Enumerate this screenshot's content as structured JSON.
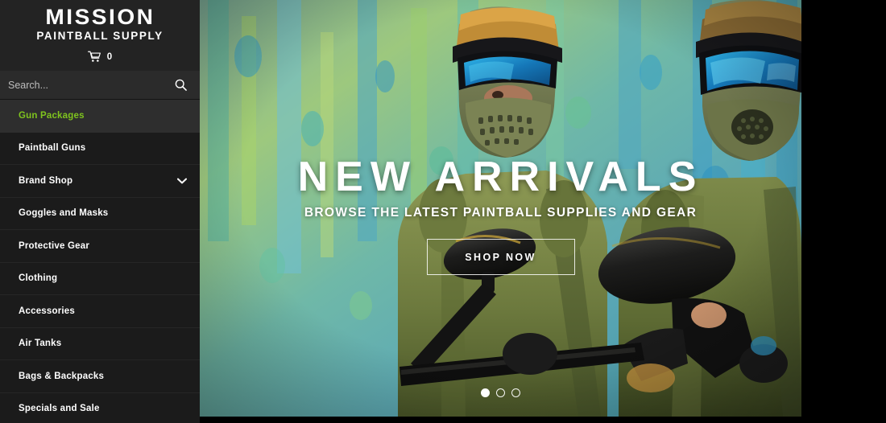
{
  "brand": {
    "name_line1": "MISSION",
    "name_line2": "PAINTBALL SUPPLY",
    "cart_icon": "shopping-cart-icon",
    "cart_count": "0"
  },
  "search": {
    "placeholder": "Search...",
    "value": "",
    "icon": "magnifier-icon"
  },
  "colors": {
    "accent_green": "#7fc41e",
    "sidebar_bg": "#1b1b1b",
    "sidebar_active_bg": "#2e2e2e",
    "header_bg": "#232323",
    "search_bg": "#2b2b2b",
    "page_bg": "#000000"
  },
  "sidebar": {
    "items": [
      {
        "label": "Gun Packages",
        "active": true,
        "expandable": false
      },
      {
        "label": "Paintball Guns",
        "active": false,
        "expandable": false
      },
      {
        "label": "Brand Shop",
        "active": false,
        "expandable": true
      },
      {
        "label": "Goggles and Masks",
        "active": false,
        "expandable": false
      },
      {
        "label": "Protective Gear",
        "active": false,
        "expandable": false
      },
      {
        "label": "Clothing",
        "active": false,
        "expandable": false
      },
      {
        "label": "Accessories",
        "active": false,
        "expandable": false
      },
      {
        "label": "Air Tanks",
        "active": false,
        "expandable": false
      },
      {
        "label": "Bags & Backpacks",
        "active": false,
        "expandable": false
      },
      {
        "label": "Specials and Sale",
        "active": false,
        "expandable": false
      }
    ]
  },
  "hero": {
    "title": "NEW ARRIVALS",
    "subtitle": "BROWSE THE LATEST PAINTBALL SUPPLIES AND GEAR",
    "cta_label": "SHOP NOW",
    "image_description": "Two paintball players in camouflage gear wearing masks with blue reflective lenses, holding black paintball markers, against a green and teal paint-splattered backdrop",
    "carousel": {
      "slide_count": 3,
      "active_index": 0
    }
  }
}
